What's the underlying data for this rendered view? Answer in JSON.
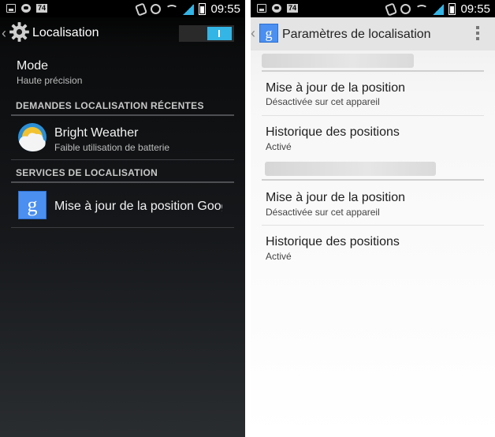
{
  "status_bar": {
    "time": "09:55",
    "badge": "74",
    "signal_color": "#33b5e5"
  },
  "left": {
    "title": "Localisation",
    "toggle_on": true,
    "accent": "#33b5e5",
    "mode": {
      "title": "Mode",
      "value": "Haute précision"
    },
    "recent_header": "DEMANDES LOCALISATION RÉCENTES",
    "recent_items": [
      {
        "title": "Bright Weather",
        "subtitle": "Faible utilisation de batterie",
        "icon": "weather-icon"
      }
    ],
    "services_header": "SERVICES DE LOCALISATION",
    "service_items": [
      {
        "title": "Mise à jour de la position Goog",
        "icon": "google-settings-icon"
      }
    ]
  },
  "right": {
    "title": "Paramètres de localisation",
    "account_groups": [
      {
        "items": [
          {
            "title": "Mise à jour de la position",
            "subtitle": "Désactivée sur cet appareil"
          },
          {
            "title": "Historique des positions",
            "subtitle": "Activé"
          }
        ]
      },
      {
        "items": [
          {
            "title": "Mise à jour de la position",
            "subtitle": "Désactivée sur cet appareil"
          },
          {
            "title": "Historique des positions",
            "subtitle": "Activé"
          }
        ]
      }
    ]
  }
}
